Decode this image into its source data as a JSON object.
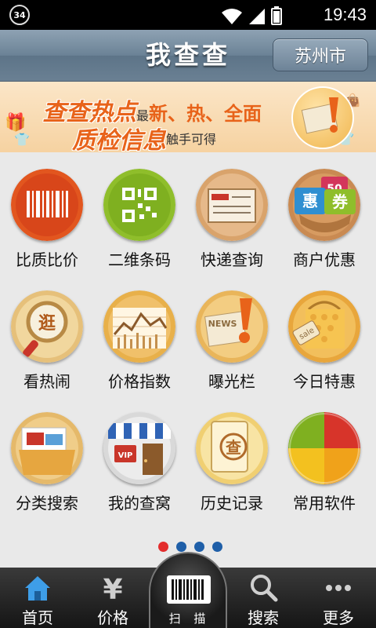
{
  "status_bar": {
    "badge": "34",
    "time": "19:43"
  },
  "header": {
    "title": "我查查",
    "city_button": "苏州市"
  },
  "banner": {
    "headline": "查查热点",
    "line1_small": "最",
    "line1_hot": "新、热、全面",
    "headline2": "质检信息",
    "line2_small": "触手可得"
  },
  "grid": {
    "items": [
      {
        "label": "比质比价",
        "icon": "barcode-icon"
      },
      {
        "label": "二维条码",
        "icon": "qrcode-icon"
      },
      {
        "label": "快递查询",
        "icon": "parcel-icon"
      },
      {
        "label": "商户优惠",
        "icon": "coupon-icon"
      },
      {
        "label": "看热闹",
        "icon": "magnifier-icon"
      },
      {
        "label": "价格指数",
        "icon": "chart-icon"
      },
      {
        "label": "曝光栏",
        "icon": "news-alert-icon"
      },
      {
        "label": "今日特惠",
        "icon": "sale-tag-icon"
      },
      {
        "label": "分类搜索",
        "icon": "folder-icon"
      },
      {
        "label": "我的查窝",
        "icon": "shop-icon"
      },
      {
        "label": "历史记录",
        "icon": "history-icon"
      },
      {
        "label": "常用软件",
        "icon": "apps-icon"
      }
    ],
    "icon_glyphs": {
      "magnifier": "逛",
      "coupon_a": "惠",
      "coupon_b": "券",
      "coupon_c": "50",
      "history": "查",
      "vip": "VIP",
      "news": "NEWS",
      "sale": "sale"
    }
  },
  "pager": {
    "pages": 4,
    "active": 0
  },
  "tabbar": {
    "home": "首页",
    "price": "价格",
    "scan": "扫 描",
    "search": "搜索",
    "more": "更多",
    "price_glyph": "¥"
  },
  "colors": {
    "active_dot": "#e32d2d",
    "dot": "#1f5fa8",
    "banner_text": "#e8631a"
  }
}
